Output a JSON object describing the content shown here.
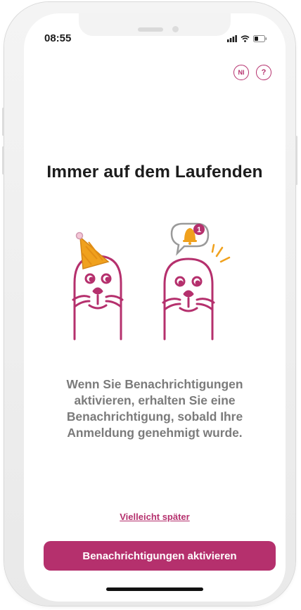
{
  "status_bar": {
    "time": "08:55"
  },
  "header": {
    "language_label": "NI",
    "help_label": "?"
  },
  "main": {
    "title": "Immer auf dem Laufenden",
    "description": "Wenn Sie Benachrichtigungen aktivieren, erhalten Sie eine Benachrichtigung, sobald Ihre Anmeldung genehmigt wurde.",
    "notification_badge": "1",
    "later_link": "Vielleicht später",
    "activate_button": "Benachrichtigungen aktivieren"
  },
  "colors": {
    "accent": "#b5306d",
    "text_dark": "#1c1c1c",
    "text_muted": "#7b7b7b",
    "party_hat": "#f0a11d"
  },
  "icons": [
    "signal-icon",
    "wifi-icon",
    "battery-icon",
    "language-icon",
    "help-icon",
    "bell-icon",
    "party-hat-icon"
  ]
}
